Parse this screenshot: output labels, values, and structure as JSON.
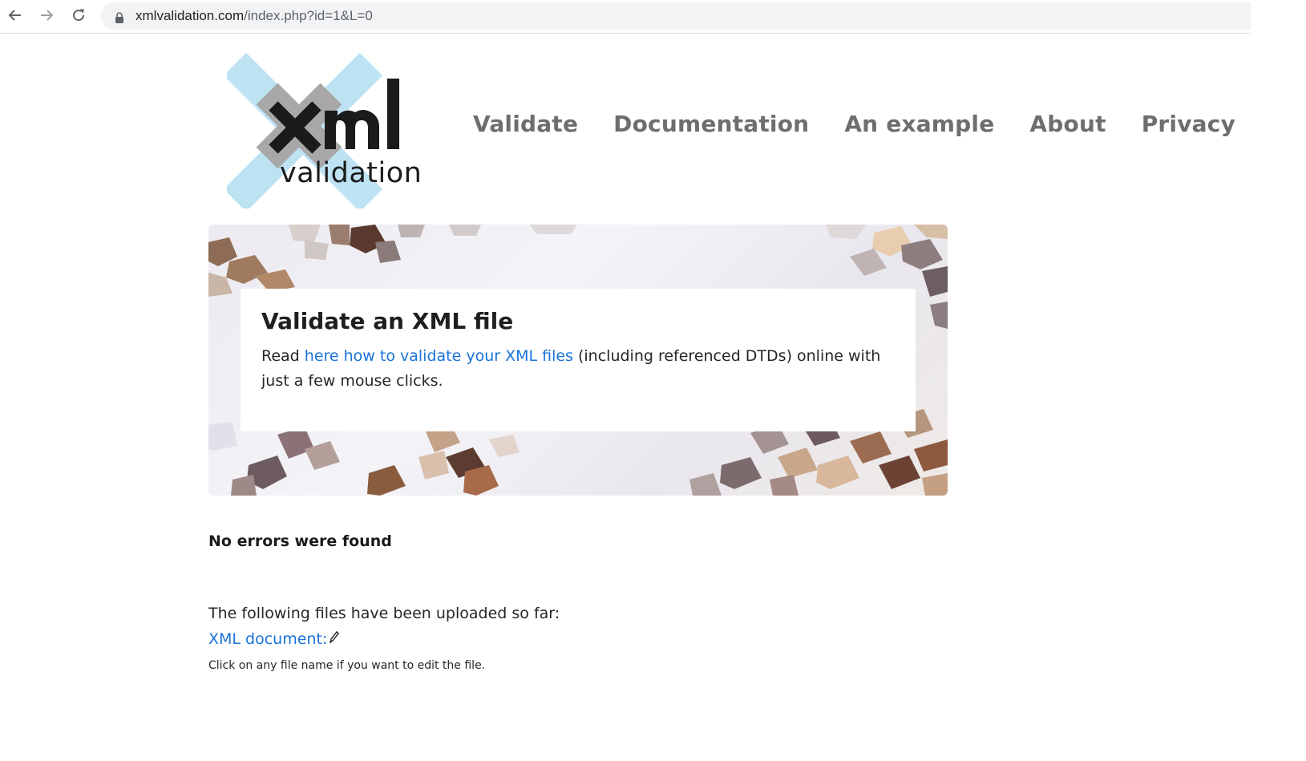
{
  "browser": {
    "url_host": "xmlvalidation.com",
    "url_path": "/index.php?id=1&L=0",
    "icons": [
      "back-icon",
      "forward-icon",
      "reload-icon",
      "lock-icon"
    ]
  },
  "site": {
    "logo_text": "xml validation",
    "nav": [
      {
        "label": "Validate"
      },
      {
        "label": "Documentation"
      },
      {
        "label": "An example"
      },
      {
        "label": "About"
      },
      {
        "label": "Privacy"
      }
    ]
  },
  "hero": {
    "title": "Validate an XML file",
    "text_before": "Read ",
    "link_text": "here how to validate your XML files",
    "text_after": " (including referenced DTDs) online with just a few mouse clicks."
  },
  "result": {
    "status": "No errors were found"
  },
  "files": {
    "intro": "The following files have been uploaded so far:",
    "items": [
      {
        "label": "XML document:",
        "icon": "pencil-icon"
      }
    ],
    "hint": "Click on any file name if you want to edit the file."
  },
  "colors": {
    "link": "#1a73d9",
    "nav": "#6e6e6e",
    "logo_x": "#bde3f3",
    "logo_x_overlap": "#a8a8a8",
    "logo_text": "#1b1b1b"
  }
}
